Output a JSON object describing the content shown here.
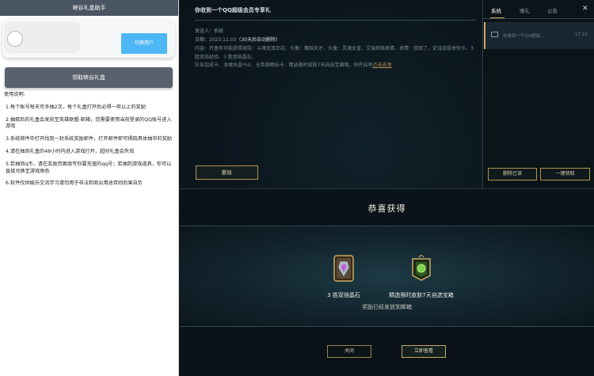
{
  "helper": {
    "title": "峡谷礼盒助手",
    "switch_user_label": "切换用户",
    "claim_button_label": "领取峡谷礼盒",
    "instructions_heading": "使用说明:",
    "instructions": [
      "1.每个账号每天可多抽2次，每个礼盒打开后必得一项以上的奖励",
      "2.抽取后的礼盒会发放至英雄联盟-邮箱，您需要使用当前登录的QQ账号进入游戏",
      "3.系统邮件中打开找到一封系统奖励邮件，打开邮件即可揭晓具体抽中的奖励",
      "4.请在抽到礼盒的48小时内进入游戏打开，超时礼盒会失效",
      "5.若抽到q币，请在奖励页面填写你要充值的qq号；若抽到游戏道具，你可以直接兑换至游戏角色",
      "6.软件仅供娱乐交流学习请勿用于非法和商业用途否则后果自负"
    ]
  },
  "mail": {
    "title": "你收到一个QQ超级会员专享礼",
    "sender": "发送人：系统",
    "date_prefix": "日期：2023.11.03",
    "date_note": "（30天后自动删除）",
    "body": "内容：开盒有可能获得皮肤：斗魂无双尼菈、头像：舞蹈天才、头像：灵魂女皇、艾瑞莉娅表情、表情：我困了，史诗皮肤体验卡、3 胜双倍经验、3 胜双倍晶石、",
    "body_line2": "队伍加成卡、龙魂水晶*50、全英雄畅玩卡、精选限时皮肤7天自选宝箱哦，快开启吧",
    "link_text": "点击去领",
    "delete_label": "删除"
  },
  "sidebar": {
    "tabs": [
      "系统",
      "赠礼",
      "公告"
    ],
    "close_glyph": "✕",
    "item_text": "你收到一个QQ超级...",
    "item_time": "17:22",
    "delete_read_label": "删除已读",
    "claim_all_label": "一键领取"
  },
  "reward": {
    "title": "恭喜获得",
    "items": [
      {
        "label": "3 胜双倍晶石",
        "icon": "crystal-card-icon"
      },
      {
        "label": "精选限时皮肤7天自选宝箱",
        "icon": "skin-chest-icon"
      }
    ],
    "note": "奖励已经发放到邮箱",
    "close_label": "关闭",
    "view_label": "立即查看"
  },
  "colors": {
    "accent_gold": "#c8a964",
    "helper_header": "#4a5563",
    "switch_button": "#4db6f5"
  }
}
